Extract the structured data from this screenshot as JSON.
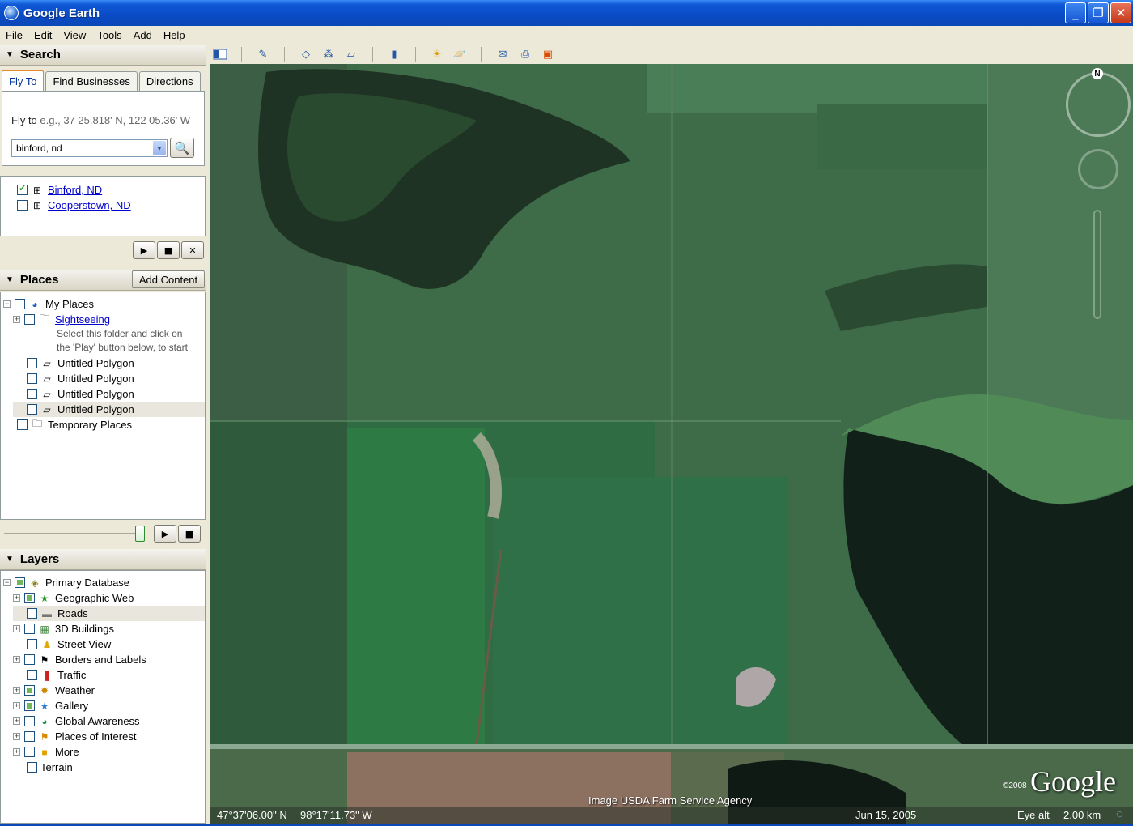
{
  "window": {
    "title": "Google Earth",
    "buttons": [
      "_",
      "❐",
      "✕"
    ]
  },
  "menu": [
    "File",
    "Edit",
    "View",
    "Tools",
    "Add",
    "Help"
  ],
  "search": {
    "header": "Search",
    "tabs": [
      "Fly To",
      "Find Businesses",
      "Directions"
    ],
    "flyto_label": "Fly to",
    "flyto_hint": "e.g., 37 25.818' N, 122 05.36' W",
    "input_value": "binford, nd",
    "results": [
      {
        "label": "Binford, ND",
        "checked": true
      },
      {
        "label": "Cooperstown, ND",
        "checked": false
      }
    ]
  },
  "places": {
    "header": "Places",
    "add_content": "Add Content",
    "items": [
      {
        "label": "My Places",
        "icon": "globe-icon"
      },
      {
        "label": "Sightseeing",
        "icon": "folder-icon",
        "link": true
      },
      {
        "label": "Untitled Polygon",
        "icon": "polygon-icon"
      },
      {
        "label": "Untitled Polygon",
        "icon": "polygon-icon"
      },
      {
        "label": "Untitled Polygon",
        "icon": "polygon-icon"
      },
      {
        "label": "Untitled Polygon",
        "icon": "polygon-icon"
      },
      {
        "label": "Temporary Places",
        "icon": "folder-icon"
      }
    ],
    "sightseeing_note_1": "Select this folder and click on",
    "sightseeing_note_2": "the 'Play' button below, to start"
  },
  "layers": {
    "header": "Layers",
    "items": [
      {
        "label": "Primary Database",
        "icon": "database-icon"
      },
      {
        "label": "Geographic Web",
        "icon": "star-icon"
      },
      {
        "label": "Roads",
        "icon": "roads-icon"
      },
      {
        "label": "3D Buildings",
        "icon": "buildings-icon"
      },
      {
        "label": "Street View",
        "icon": "pegman-icon"
      },
      {
        "label": "Borders and Labels",
        "icon": "flag-icon"
      },
      {
        "label": "Traffic",
        "icon": "traffic-light-icon"
      },
      {
        "label": "Weather",
        "icon": "sun-icon"
      },
      {
        "label": "Gallery",
        "icon": "star-icon"
      },
      {
        "label": "Global Awareness",
        "icon": "globe-icon"
      },
      {
        "label": "Places of Interest",
        "icon": "flag-icon"
      },
      {
        "label": "More",
        "icon": "square-icon"
      },
      {
        "label": "Terrain",
        "icon": ""
      }
    ]
  },
  "map": {
    "attribution": "Image USDA Farm Service Agency",
    "copyright": "©2008",
    "logo": "Google",
    "lat": "47°37'06.00\" N",
    "lon": "98°17'11.73\" W",
    "date": "Jun 15, 2005",
    "eye_alt_label": "Eye alt",
    "eye_alt_value": "2.00 km",
    "compass_n": "N"
  }
}
